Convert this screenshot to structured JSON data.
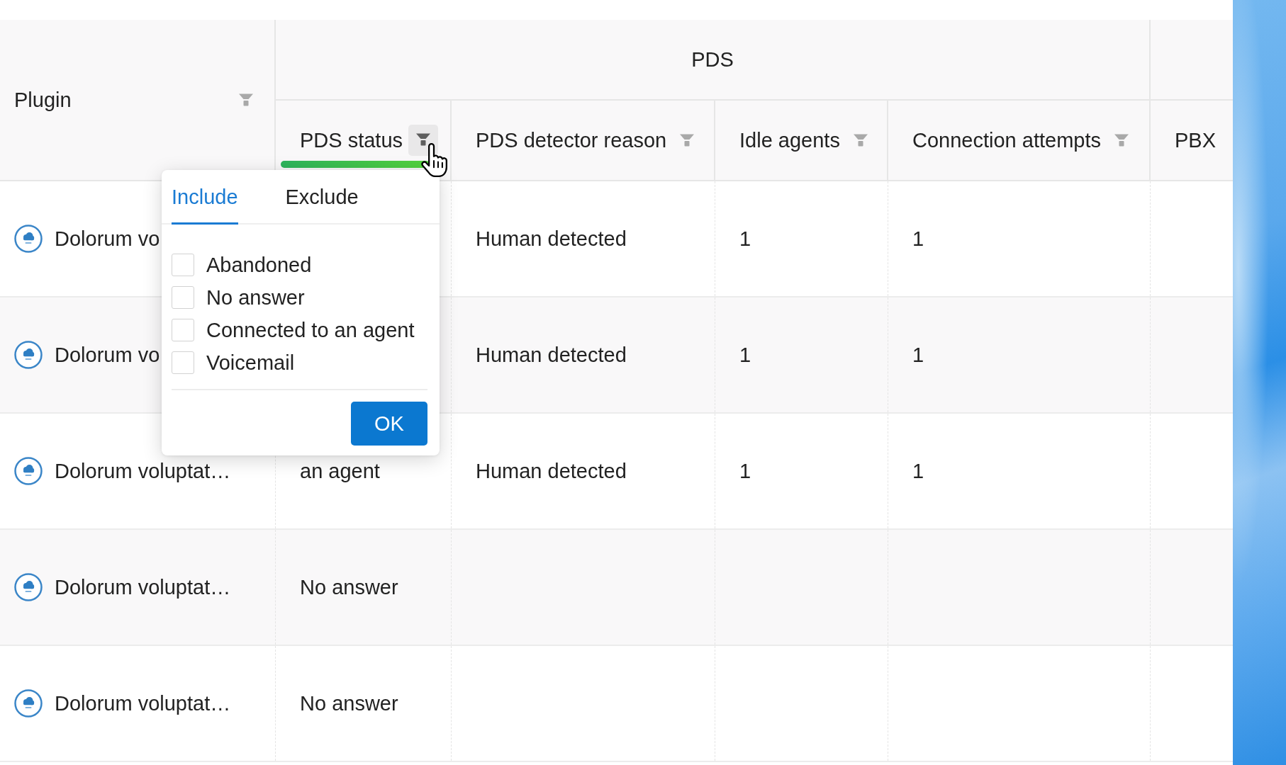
{
  "table": {
    "plugin_column": {
      "label": "Plugin",
      "filter": true,
      "filter_open": false
    },
    "column_groups": [
      {
        "label": "PDS",
        "columns": [
          {
            "label": "PDS status",
            "filter": true,
            "filter_open": true
          },
          {
            "label": "PDS detector reason",
            "filter": true,
            "filter_open": false
          },
          {
            "label": "Idle agents",
            "filter": true,
            "filter_open": false
          },
          {
            "label": "Connection attempts",
            "filter": true,
            "filter_open": false
          }
        ]
      },
      {
        "columns": [
          {
            "label": "PBX",
            "filter": false
          }
        ]
      }
    ],
    "rows": [
      {
        "plugin": "Dolorum vo",
        "pds_detector_reason": "Human detected",
        "idle_agents": "1",
        "connection_attempts": "1"
      },
      {
        "plugin": "Dolorum vo",
        "pds_detector_reason": "Human detected",
        "idle_agents": "1",
        "connection_attempts": "1"
      },
      {
        "plugin": "Dolorum voluptat…",
        "pds_status": "an agent",
        "pds_detector_reason": "Human detected",
        "idle_agents": "1",
        "connection_attempts": "1"
      },
      {
        "plugin": "Dolorum voluptat…",
        "pds_status": "No answer"
      },
      {
        "plugin": "Dolorum voluptat…",
        "pds_status": "No answer"
      }
    ],
    "filter_popup": {
      "tabs": [
        {
          "label": "Include",
          "selected": true
        },
        {
          "label": "Exclude",
          "selected": false
        }
      ],
      "options": [
        {
          "label": "Abandoned",
          "checked": false
        },
        {
          "label": "No answer",
          "checked": false
        },
        {
          "label": "Connected to an agent",
          "checked": false
        },
        {
          "label": "Voicemail",
          "checked": false
        }
      ],
      "ok_button": "OK"
    }
  }
}
